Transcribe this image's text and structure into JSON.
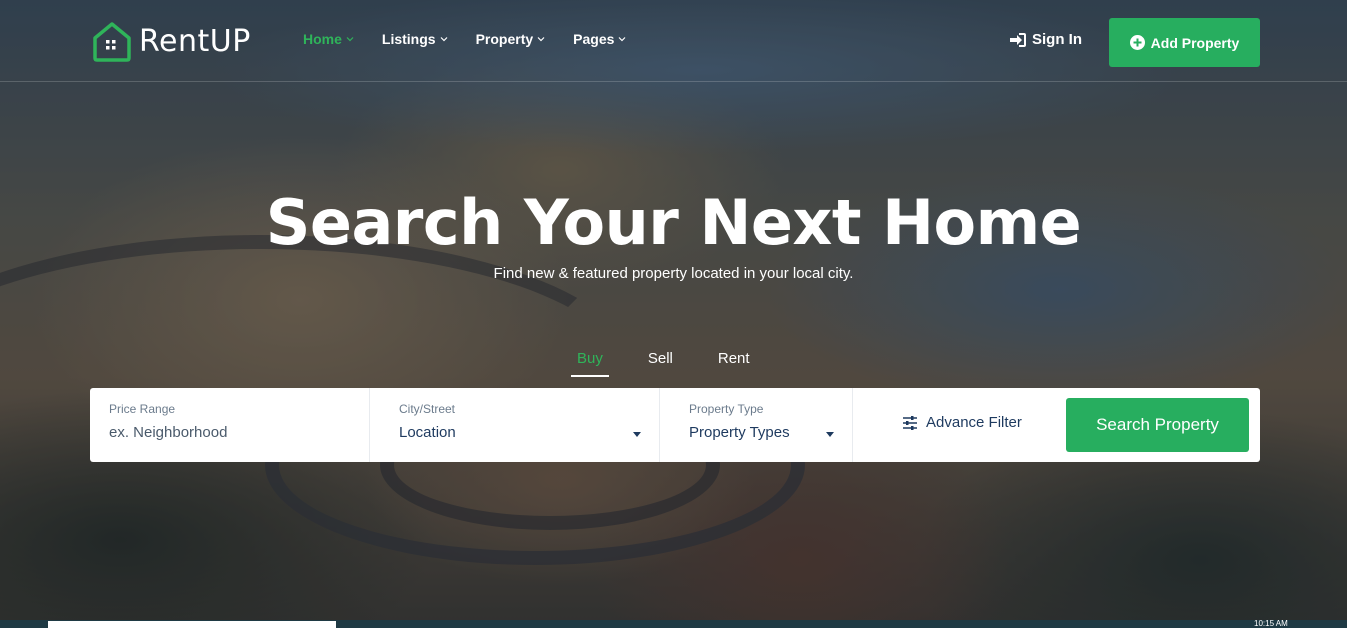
{
  "brand": {
    "name": "RentUP",
    "icon": "house-icon",
    "accent": "#27ae5f"
  },
  "nav": {
    "items": [
      {
        "label": "Home",
        "active": true
      },
      {
        "label": "Listings",
        "active": false
      },
      {
        "label": "Property",
        "active": false
      },
      {
        "label": "Pages",
        "active": false
      }
    ],
    "signin_label": "Sign In",
    "add_property_label": "Add Property"
  },
  "hero": {
    "title": "Search Your Next Home",
    "subtitle": "Find new & featured property located in your local city."
  },
  "tabs": [
    {
      "label": "Buy",
      "active": true
    },
    {
      "label": "Sell",
      "active": false
    },
    {
      "label": "Rent",
      "active": false
    }
  ],
  "search": {
    "price_label": "Price Range",
    "price_placeholder": "ex. Neighborhood",
    "city_label": "City/Street",
    "city_value": "Location",
    "type_label": "Property Type",
    "type_value": "Property Types",
    "advance_filter_label": "Advance Filter",
    "search_button_label": "Search Property"
  },
  "taskbar": {
    "time": "10:15 AM"
  }
}
